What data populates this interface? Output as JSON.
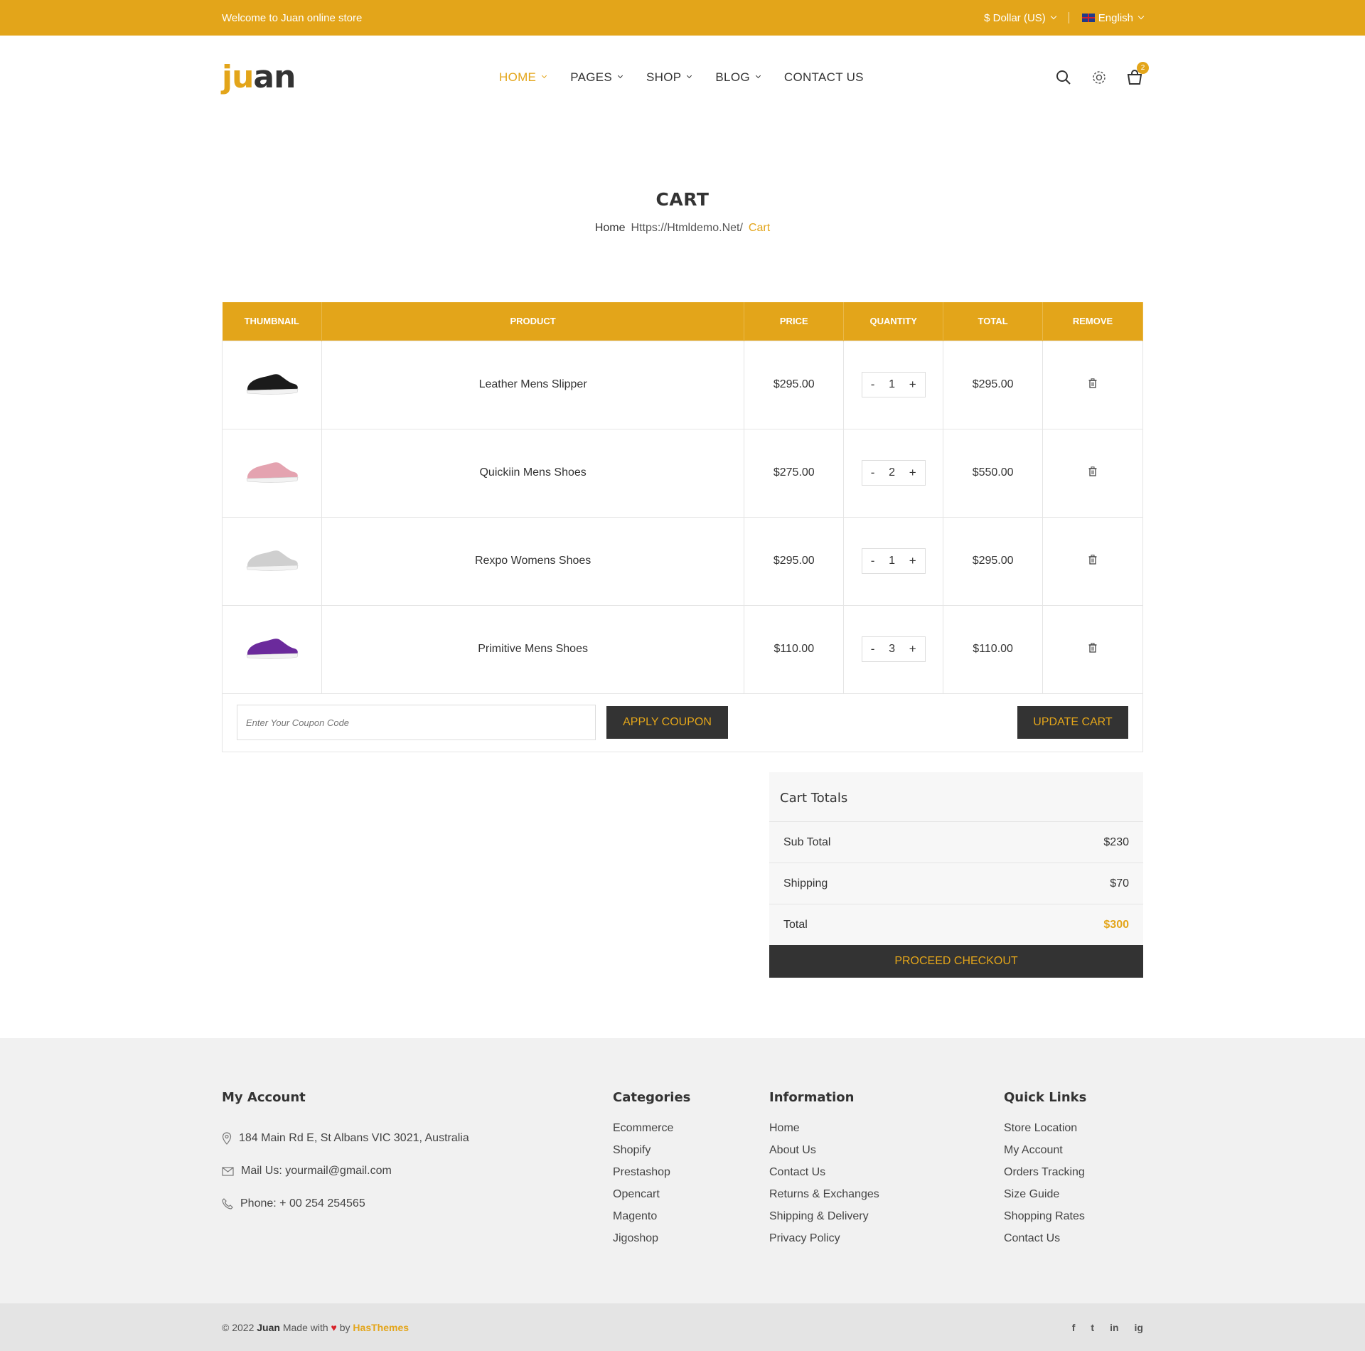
{
  "topbar": {
    "welcome": "Welcome to Juan online store",
    "currency": "$ Dollar (US)",
    "language": "English"
  },
  "header": {
    "logo_part1": "ju",
    "logo_part2": "an",
    "nav": [
      "HOME",
      "PAGES",
      "SHOP",
      "BLOG",
      "CONTACT US"
    ],
    "cart_count": "2"
  },
  "page": {
    "title": "CART",
    "breadcrumb_home": "Home",
    "breadcrumb_mid": "Https://Htmldemo.Net/",
    "breadcrumb_current": "Cart"
  },
  "cart": {
    "headers": [
      "THUMBNAIL",
      "PRODUCT",
      "PRICE",
      "QUANTITY",
      "TOTAL",
      "REMOVE"
    ],
    "items": [
      {
        "name": "Leather Mens Slipper",
        "price": "$295.00",
        "qty": "1",
        "total": "$295.00",
        "color": "#1b1b1b"
      },
      {
        "name": "Quickiin Mens Shoes",
        "price": "$275.00",
        "qty": "2",
        "total": "$550.00",
        "color": "#e4a3b0"
      },
      {
        "name": "Rexpo Womens Shoes",
        "price": "$295.00",
        "qty": "1",
        "total": "$295.00",
        "color": "#cfcfcf"
      },
      {
        "name": "Primitive Mens Shoes",
        "price": "$110.00",
        "qty": "3",
        "total": "$110.00",
        "color": "#6b2a9c"
      }
    ],
    "coupon_placeholder": "Enter Your Coupon Code",
    "apply_label": "APPLY COUPON",
    "update_label": "UPDATE CART"
  },
  "totals": {
    "title": "Cart Totals",
    "subtotal_label": "Sub Total",
    "subtotal": "$230",
    "shipping_label": "Shipping",
    "shipping": "$70",
    "total_label": "Total",
    "total": "$300",
    "checkout_label": "PROCEED CHECKOUT"
  },
  "footer": {
    "account_title": "My Account",
    "address": "184 Main Rd E, St Albans VIC 3021, Australia",
    "mail": "Mail Us: yourmail@gmail.com",
    "phone": "Phone: + 00 254 254565",
    "categories_title": "Categories",
    "categories": [
      "Ecommerce",
      "Shopify",
      "Prestashop",
      "Opencart",
      "Magento",
      "Jigoshop"
    ],
    "information_title": "Information",
    "information": [
      "Home",
      "About Us",
      "Contact Us",
      "Returns & Exchanges",
      "Shipping & Delivery",
      "Privacy Policy"
    ],
    "quicklinks_title": "Quick Links",
    "quicklinks": [
      "Store Location",
      "My Account",
      "Orders Tracking",
      "Size Guide",
      "Shopping Rates",
      "Contact Us"
    ],
    "copy_prefix": "© 2022",
    "copy_brand": "Juan",
    "copy_made": "Made with",
    "copy_by": "by",
    "copy_author": "HasThemes",
    "social": [
      "f",
      "t",
      "in",
      "ig"
    ]
  },
  "colors": {
    "accent": "#e3a51a",
    "dark": "#333333"
  }
}
